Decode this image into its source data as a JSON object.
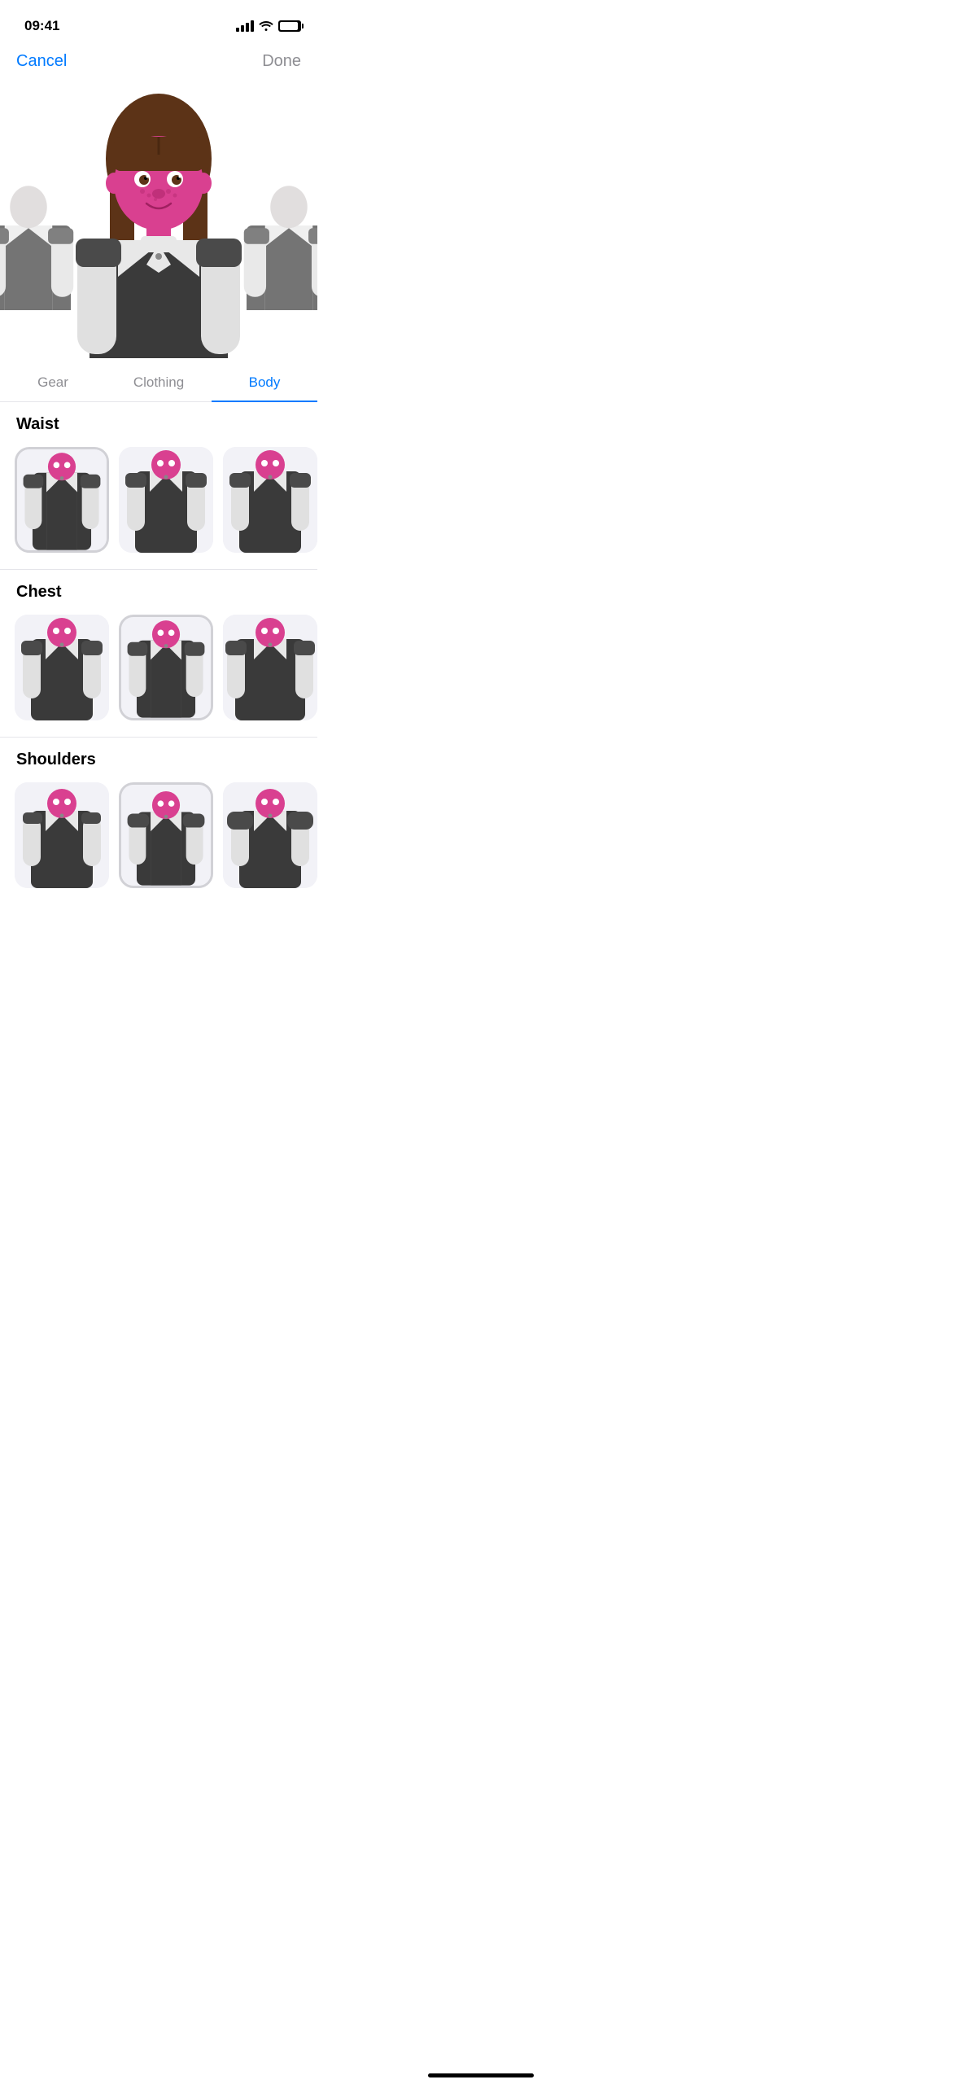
{
  "statusBar": {
    "time": "09:41"
  },
  "navBar": {
    "cancelLabel": "Cancel",
    "doneLabel": "Done"
  },
  "segments": [
    {
      "id": "gear",
      "label": "Gear",
      "active": false
    },
    {
      "id": "clothing",
      "label": "Clothing",
      "active": false
    },
    {
      "id": "body",
      "label": "Body",
      "active": true
    }
  ],
  "sections": [
    {
      "id": "waist",
      "title": "Waist",
      "items": [
        {
          "selected": true
        },
        {
          "selected": false
        },
        {
          "selected": false
        }
      ]
    },
    {
      "id": "chest",
      "title": "Chest",
      "items": [
        {
          "selected": false
        },
        {
          "selected": true
        },
        {
          "selected": false
        }
      ]
    },
    {
      "id": "shoulders",
      "title": "Shoulders",
      "items": [
        {
          "selected": false
        },
        {
          "selected": true
        },
        {
          "selected": false
        }
      ]
    }
  ],
  "homeIndicator": true
}
